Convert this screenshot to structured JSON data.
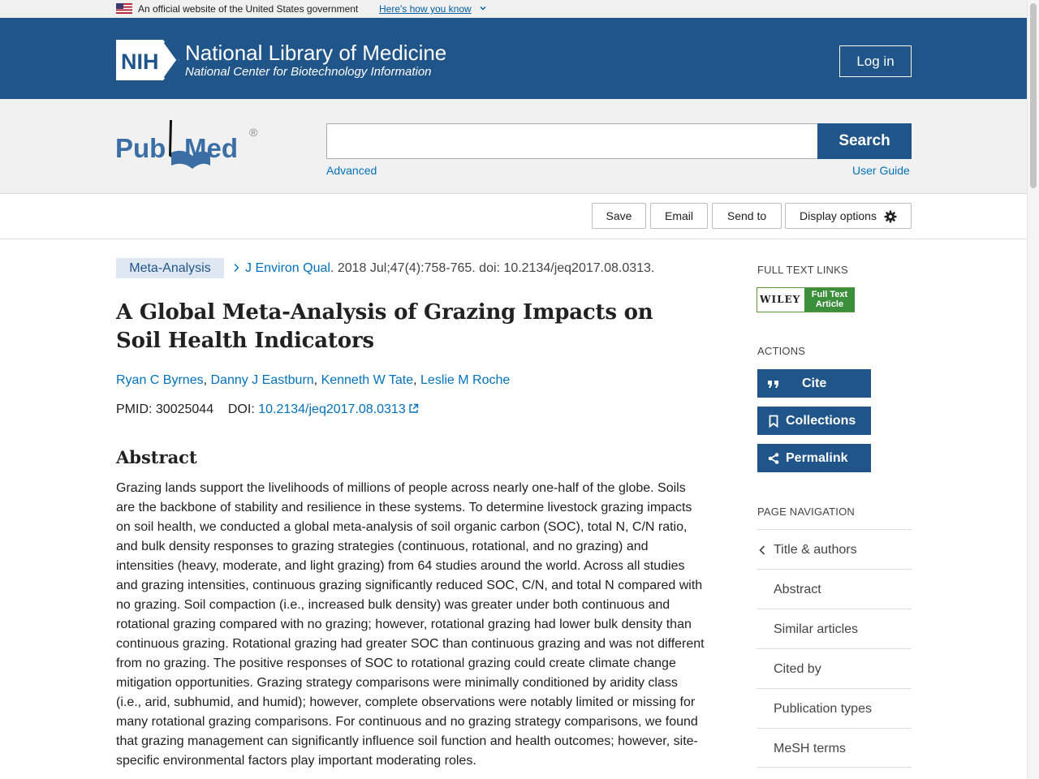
{
  "gov_banner": {
    "text": "An official website of the United States government",
    "link": "Here's how you know"
  },
  "header": {
    "nih_mark": "NIH",
    "title": "National Library of Medicine",
    "subtitle": "National Center for Biotechnology Information",
    "login_label": "Log in"
  },
  "search": {
    "logo_text_left": "Pub",
    "logo_text_right": "Med",
    "logo_reg": "®",
    "query": "",
    "placeholder": "",
    "button_label": "Search",
    "advanced_label": "Advanced",
    "user_guide_label": "User Guide"
  },
  "toolbar": {
    "save": "Save",
    "email": "Email",
    "send_to": "Send to",
    "display_options": "Display options"
  },
  "article": {
    "pub_type": "Meta-Analysis",
    "journal": "J Environ Qual",
    "citation_rest": ". 2018 Jul;47(4):758-765. doi: 10.2134/jeq2017.08.0313.",
    "title": "A Global Meta-Analysis of Grazing Impacts on Soil Health Indicators",
    "authors": [
      "Ryan C Byrnes",
      "Danny J Eastburn",
      "Kenneth W Tate",
      "Leslie M Roche"
    ],
    "author_sep": ", ",
    "pmid_label": "PMID:",
    "pmid": "30025044",
    "doi_label": "DOI:",
    "doi": "10.2134/jeq2017.08.0313",
    "abstract_heading": "Abstract",
    "abstract": "Grazing lands support the livelihoods of millions of people across nearly one-half of the globe. Soils are the backbone of stability and resilience in these systems. To determine livestock grazing impacts on soil health, we conducted a global meta-analysis of soil organic carbon (SOC), total N, C/N ratio, and bulk density responses to grazing strategies (continuous, rotational, and no grazing) and intensities (heavy, moderate, and light grazing) from 64 studies around the world. Across all studies and grazing intensities, continuous grazing significantly reduced SOC, C/N, and total N compared with no grazing. Soil compaction (i.e., increased bulk density) was greater under both continuous and rotational grazing compared with no grazing; however, rotational grazing had lower bulk density than continuous grazing. Rotational grazing had greater SOC than continuous grazing and was not different from no grazing. The positive responses of SOC to rotational grazing could create climate change mitigation opportunities. Grazing strategy comparisons were minimally conditioned by aridity class (i.e., arid, subhumid, and humid); however, complete observations were notably limited or missing for many rotational grazing comparisons. For continuous and no grazing strategy comparisons, we found that grazing management can significantly influence soil function and health outcomes; however, site-specific environmental factors play important moderating roles."
  },
  "sidebar": {
    "full_text_heading": "FULL TEXT LINKS",
    "wiley_word": "WILEY",
    "wiley_line1": "Full Text",
    "wiley_line2": "Article",
    "actions_heading": "ACTIONS",
    "cite": "Cite",
    "collections": "Collections",
    "permalink": "Permalink",
    "nav_heading": "PAGE NAVIGATION",
    "nav_items": [
      "Title & authors",
      "Abstract",
      "Similar articles",
      "Cited by",
      "Publication types",
      "MeSH terms"
    ]
  },
  "colors": {
    "header_blue": "#20558a",
    "link_blue": "#0071bc",
    "badge_bg": "#dfe8f2"
  }
}
